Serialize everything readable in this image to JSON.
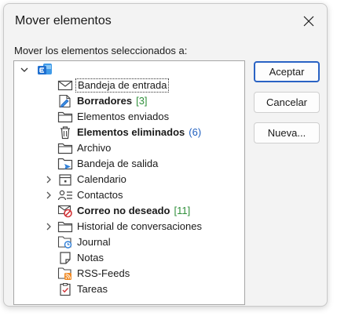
{
  "dialog": {
    "title": "Mover elementos",
    "prompt": "Mover los elementos seleccionados a:"
  },
  "buttons": {
    "accept": "Aceptar",
    "cancel": "Cancelar",
    "new": "Nueva..."
  },
  "tree": {
    "root_icon": "exchange-account-icon",
    "items": [
      {
        "label": "Bandeja de entrada",
        "icon": "envelope-icon",
        "selected": true
      },
      {
        "label": "Borradores",
        "count": "[3]",
        "count_color": "#2f8f3a",
        "bold": true,
        "icon": "drafts-icon"
      },
      {
        "label": "Elementos enviados",
        "icon": "folder-icon"
      },
      {
        "label": "Elementos eliminados",
        "count": "(6)",
        "count_color": "#1f5fbf",
        "bold": true,
        "icon": "trash-icon"
      },
      {
        "label": "Archivo",
        "icon": "folder-icon"
      },
      {
        "label": "Bandeja de salida",
        "icon": "outbox-icon"
      },
      {
        "label": "Calendario",
        "icon": "calendar-icon",
        "expandable": true
      },
      {
        "label": "Contactos",
        "icon": "contacts-icon",
        "expandable": true
      },
      {
        "label": "Correo no deseado",
        "count": "[11]",
        "count_color": "#2f8f3a",
        "bold": true,
        "icon": "junk-icon"
      },
      {
        "label": "Historial de conversaciones",
        "icon": "folder-icon",
        "expandable": true
      },
      {
        "label": "Journal",
        "icon": "journal-icon"
      },
      {
        "label": "Notas",
        "icon": "notes-icon"
      },
      {
        "label": "RSS-Feeds",
        "icon": "rss-icon"
      },
      {
        "label": "Tareas",
        "icon": "tasks-icon"
      }
    ]
  },
  "colors": {
    "accent": "#2a63c4",
    "exchange": "#1f6fd0"
  }
}
